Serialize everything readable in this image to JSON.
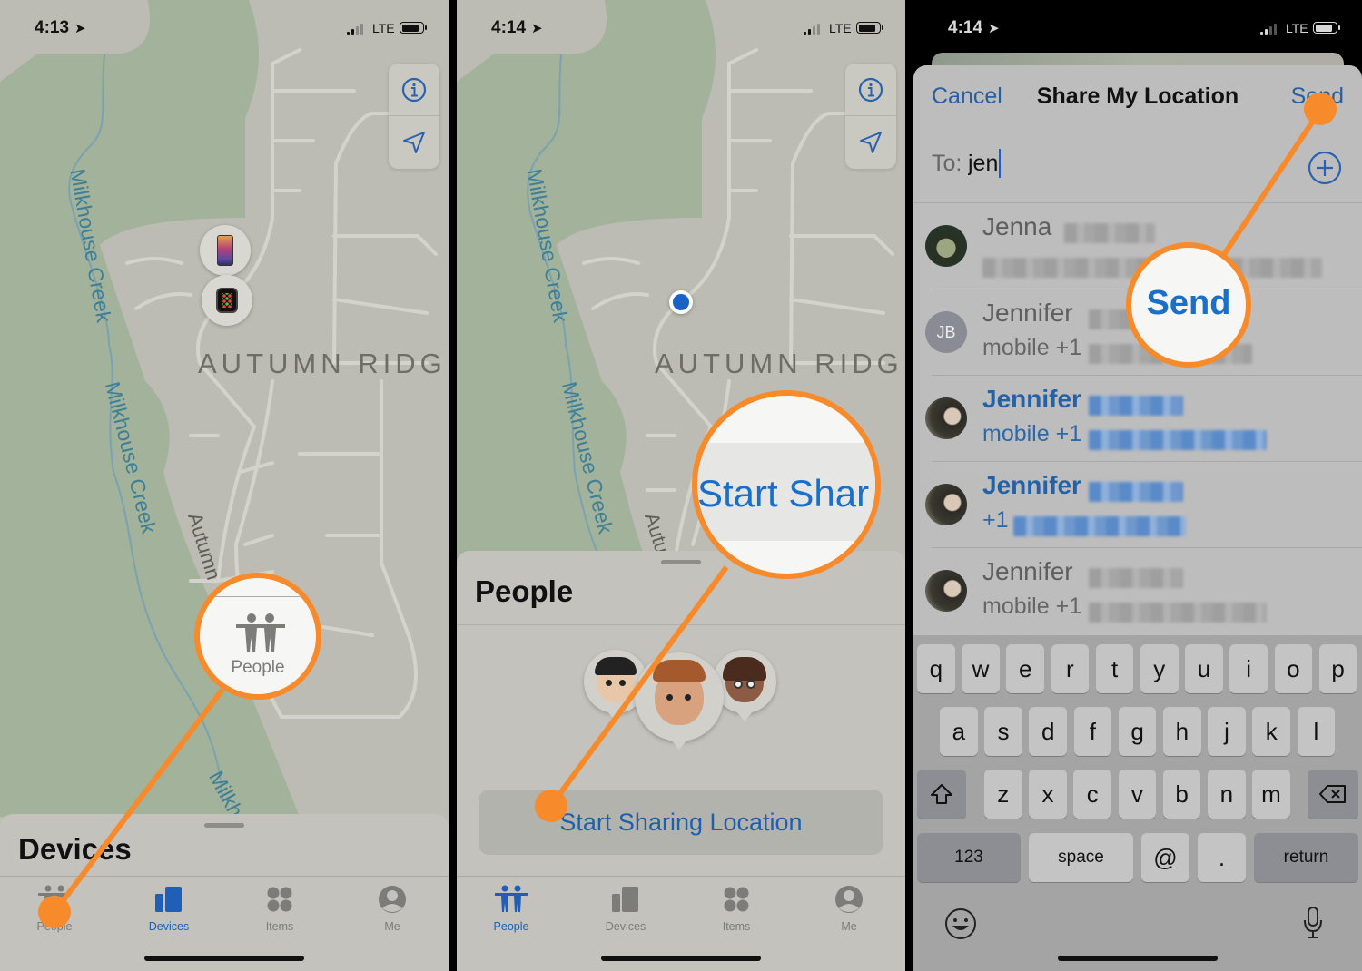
{
  "accent": "#1f5fb8",
  "callout_color": "#f78a2a",
  "panels": [
    {
      "status": {
        "time": "4:13",
        "network": "LTE"
      },
      "map": {
        "area_label": "AUTUMN RIDG",
        "creek_labels": [
          "Milkhouse Creek",
          "Milkhouse Creek",
          "Milkh"
        ],
        "road_label": "Autumn"
      },
      "map_controls": {
        "info": "info-icon",
        "locate": "location-arrow-icon"
      },
      "device_pins": [
        "iPhone",
        "Apple Watch"
      ],
      "sheet": {
        "title": "Devices"
      },
      "tabs": [
        {
          "label": "People",
          "icon": "people-icon",
          "active": false
        },
        {
          "label": "Devices",
          "icon": "devices-icon",
          "active": true
        },
        {
          "label": "Items",
          "icon": "items-icon",
          "active": false
        },
        {
          "label": "Me",
          "icon": "me-icon",
          "active": false
        }
      ],
      "magnifier": {
        "label": "People"
      }
    },
    {
      "status": {
        "time": "4:14",
        "network": "LTE"
      },
      "map": {
        "area_label": "AUTUMN RIDG",
        "creek_label": "Milkhouse Creek",
        "road_label": "Autu"
      },
      "sheet": {
        "title": "People",
        "button": "Start Sharing Location"
      },
      "tabs": [
        {
          "label": "People",
          "icon": "people-icon",
          "active": true
        },
        {
          "label": "Devices",
          "icon": "devices-icon",
          "active": false
        },
        {
          "label": "Items",
          "icon": "items-icon",
          "active": false
        },
        {
          "label": "Me",
          "icon": "me-icon",
          "active": false
        }
      ],
      "magnifier": {
        "label": "Start Shar"
      }
    },
    {
      "status": {
        "time": "4:14",
        "network": "LTE"
      },
      "modal": {
        "cancel": "Cancel",
        "title": "Share My Location",
        "send": "Send",
        "to_label": "To:",
        "to_value": "jen"
      },
      "contacts": [
        {
          "name": "Jenna",
          "sub": "",
          "avatar": "photo",
          "initials": "",
          "highlighted": false
        },
        {
          "name": "Jennifer",
          "sub": "mobile +1",
          "avatar": "initials",
          "initials": "JB",
          "highlighted": false
        },
        {
          "name": "Jennifer",
          "sub": "mobile +1",
          "avatar": "photo",
          "initials": "",
          "highlighted": true
        },
        {
          "name": "Jennifer",
          "sub": "+1",
          "avatar": "photo",
          "initials": "",
          "highlighted": true
        },
        {
          "name": "Jennifer",
          "sub": "mobile +1",
          "avatar": "photo",
          "initials": "",
          "highlighted": false
        }
      ],
      "keyboard": {
        "row1": [
          "q",
          "w",
          "e",
          "r",
          "t",
          "y",
          "u",
          "i",
          "o",
          "p"
        ],
        "row2": [
          "a",
          "s",
          "d",
          "f",
          "g",
          "h",
          "j",
          "k",
          "l"
        ],
        "row3": [
          "z",
          "x",
          "c",
          "v",
          "b",
          "n",
          "m"
        ],
        "numbers": "123",
        "space": "space",
        "at": "@",
        "period": ".",
        "return": "return"
      },
      "magnifier": {
        "label": "Send"
      }
    }
  ]
}
